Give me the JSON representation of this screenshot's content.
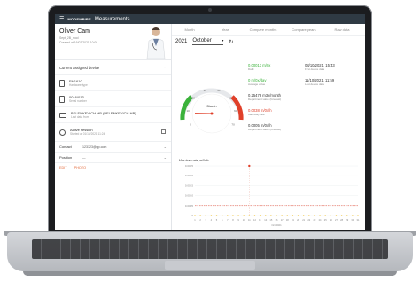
{
  "app": {
    "title": "Measurements",
    "logo_text": "MODEMPIRE"
  },
  "profile": {
    "name": "Oliver Cam",
    "line1": "Sept_2B_mod",
    "line2": "Created at 16/02/2021 10:00"
  },
  "devices": {
    "header": "Current assigned device",
    "items": [
      {
        "name": "FM1610",
        "sub": "Hardware type"
      },
      {
        "name": "0016/013",
        "sub": "Serial number"
      },
      {
        "name": "BELENKEVICH-HB (BELENKEVICH-HB)",
        "sub": "Last data from"
      }
    ]
  },
  "session": {
    "title": "Active session",
    "sub": "Started at 01/10/2021 11:24"
  },
  "fields": [
    {
      "label": "Contact",
      "value": "123123@gp.com"
    },
    {
      "label": "Position",
      "value": "—"
    }
  ],
  "actions": {
    "edit": "EDIT",
    "photo": "PHOTO"
  },
  "tabs": [
    "Month",
    "Year",
    "Compare months",
    "Compare years",
    "Raw data"
  ],
  "filters": {
    "year": "2021",
    "month": "October"
  },
  "gauge": {
    "label": "Bias  In",
    "value_fraction": 0.12,
    "ticks": [
      "0",
      "10",
      "20",
      "30",
      "40",
      "50",
      "60",
      "70"
    ]
  },
  "kpis": {
    "k1": {
      "value": "0.00013 m/0x",
      "sub": "Daily"
    },
    "k2": {
      "value": "0 m/0x/day",
      "sub": "Average value"
    },
    "k3": {
      "value": "0.25478 m3x/month",
      "sub": "Department value (forecast)"
    },
    "k4": {
      "value": "0.0038 m/0x/h",
      "sub": "Max daily rate"
    },
    "k5": {
      "value": "0.0005 m/0x/h",
      "sub": "Department value (forecast)"
    },
    "d1": {
      "value": "08/10/2021, 15:43",
      "sub": "First device data"
    },
    "d2": {
      "value": "11/10/2021, 11:59",
      "sub": "Last device data"
    }
  },
  "chart_data": {
    "type": "line",
    "title": "Max draw rate, m/0x/h",
    "x": [
      "1",
      "2",
      "3",
      "4",
      "5",
      "6",
      "7",
      "8",
      "9",
      "10",
      "11",
      "12",
      "13",
      "14",
      "15",
      "16",
      "17",
      "18",
      "19",
      "20",
      "21",
      "22",
      "23",
      "24",
      "25",
      "26",
      "27",
      "28",
      "29",
      "30",
      "31"
    ],
    "ylabels": [
      "0.0025",
      "0.0020",
      "0.0015",
      "0.0010",
      "0.0005",
      "0"
    ],
    "xlabel": "Oct 2021",
    "point": {
      "x": 11,
      "y": 0.0025
    },
    "threshold": 0.0005,
    "colors": {
      "point": "#e0402a",
      "threshold": "#e0402a",
      "base": "#f2c94c"
    }
  }
}
